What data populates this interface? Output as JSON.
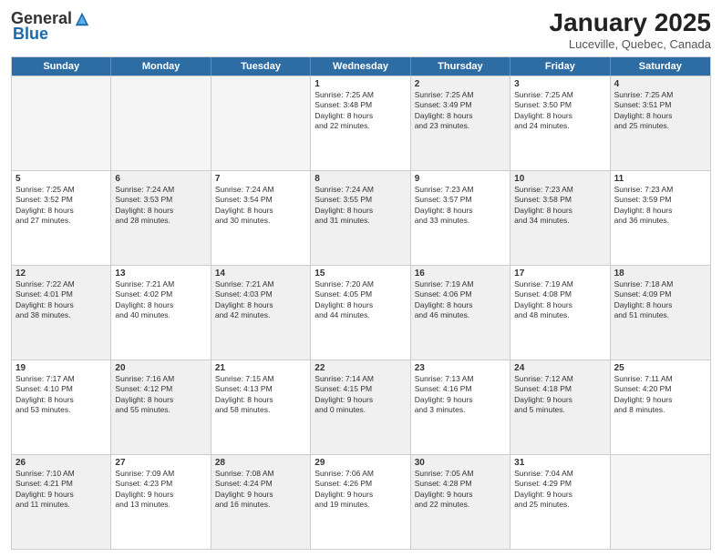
{
  "header": {
    "logo_general": "General",
    "logo_blue": "Blue",
    "month_title": "January 2025",
    "location": "Luceville, Quebec, Canada"
  },
  "days_of_week": [
    "Sunday",
    "Monday",
    "Tuesday",
    "Wednesday",
    "Thursday",
    "Friday",
    "Saturday"
  ],
  "weeks": [
    [
      {
        "day": "",
        "text": "",
        "shaded": true,
        "empty": true
      },
      {
        "day": "",
        "text": "",
        "shaded": true,
        "empty": true
      },
      {
        "day": "",
        "text": "",
        "shaded": true,
        "empty": true
      },
      {
        "day": "1",
        "text": "Sunrise: 7:25 AM\nSunset: 3:48 PM\nDaylight: 8 hours\nand 22 minutes.",
        "shaded": false
      },
      {
        "day": "2",
        "text": "Sunrise: 7:25 AM\nSunset: 3:49 PM\nDaylight: 8 hours\nand 23 minutes.",
        "shaded": true
      },
      {
        "day": "3",
        "text": "Sunrise: 7:25 AM\nSunset: 3:50 PM\nDaylight: 8 hours\nand 24 minutes.",
        "shaded": false
      },
      {
        "day": "4",
        "text": "Sunrise: 7:25 AM\nSunset: 3:51 PM\nDaylight: 8 hours\nand 25 minutes.",
        "shaded": true
      }
    ],
    [
      {
        "day": "5",
        "text": "Sunrise: 7:25 AM\nSunset: 3:52 PM\nDaylight: 8 hours\nand 27 minutes.",
        "shaded": false
      },
      {
        "day": "6",
        "text": "Sunrise: 7:24 AM\nSunset: 3:53 PM\nDaylight: 8 hours\nand 28 minutes.",
        "shaded": true
      },
      {
        "day": "7",
        "text": "Sunrise: 7:24 AM\nSunset: 3:54 PM\nDaylight: 8 hours\nand 30 minutes.",
        "shaded": false
      },
      {
        "day": "8",
        "text": "Sunrise: 7:24 AM\nSunset: 3:55 PM\nDaylight: 8 hours\nand 31 minutes.",
        "shaded": true
      },
      {
        "day": "9",
        "text": "Sunrise: 7:23 AM\nSunset: 3:57 PM\nDaylight: 8 hours\nand 33 minutes.",
        "shaded": false
      },
      {
        "day": "10",
        "text": "Sunrise: 7:23 AM\nSunset: 3:58 PM\nDaylight: 8 hours\nand 34 minutes.",
        "shaded": true
      },
      {
        "day": "11",
        "text": "Sunrise: 7:23 AM\nSunset: 3:59 PM\nDaylight: 8 hours\nand 36 minutes.",
        "shaded": false
      }
    ],
    [
      {
        "day": "12",
        "text": "Sunrise: 7:22 AM\nSunset: 4:01 PM\nDaylight: 8 hours\nand 38 minutes.",
        "shaded": true
      },
      {
        "day": "13",
        "text": "Sunrise: 7:21 AM\nSunset: 4:02 PM\nDaylight: 8 hours\nand 40 minutes.",
        "shaded": false
      },
      {
        "day": "14",
        "text": "Sunrise: 7:21 AM\nSunset: 4:03 PM\nDaylight: 8 hours\nand 42 minutes.",
        "shaded": true
      },
      {
        "day": "15",
        "text": "Sunrise: 7:20 AM\nSunset: 4:05 PM\nDaylight: 8 hours\nand 44 minutes.",
        "shaded": false
      },
      {
        "day": "16",
        "text": "Sunrise: 7:19 AM\nSunset: 4:06 PM\nDaylight: 8 hours\nand 46 minutes.",
        "shaded": true
      },
      {
        "day": "17",
        "text": "Sunrise: 7:19 AM\nSunset: 4:08 PM\nDaylight: 8 hours\nand 48 minutes.",
        "shaded": false
      },
      {
        "day": "18",
        "text": "Sunrise: 7:18 AM\nSunset: 4:09 PM\nDaylight: 8 hours\nand 51 minutes.",
        "shaded": true
      }
    ],
    [
      {
        "day": "19",
        "text": "Sunrise: 7:17 AM\nSunset: 4:10 PM\nDaylight: 8 hours\nand 53 minutes.",
        "shaded": false
      },
      {
        "day": "20",
        "text": "Sunrise: 7:16 AM\nSunset: 4:12 PM\nDaylight: 8 hours\nand 55 minutes.",
        "shaded": true
      },
      {
        "day": "21",
        "text": "Sunrise: 7:15 AM\nSunset: 4:13 PM\nDaylight: 8 hours\nand 58 minutes.",
        "shaded": false
      },
      {
        "day": "22",
        "text": "Sunrise: 7:14 AM\nSunset: 4:15 PM\nDaylight: 9 hours\nand 0 minutes.",
        "shaded": true
      },
      {
        "day": "23",
        "text": "Sunrise: 7:13 AM\nSunset: 4:16 PM\nDaylight: 9 hours\nand 3 minutes.",
        "shaded": false
      },
      {
        "day": "24",
        "text": "Sunrise: 7:12 AM\nSunset: 4:18 PM\nDaylight: 9 hours\nand 5 minutes.",
        "shaded": true
      },
      {
        "day": "25",
        "text": "Sunrise: 7:11 AM\nSunset: 4:20 PM\nDaylight: 9 hours\nand 8 minutes.",
        "shaded": false
      }
    ],
    [
      {
        "day": "26",
        "text": "Sunrise: 7:10 AM\nSunset: 4:21 PM\nDaylight: 9 hours\nand 11 minutes.",
        "shaded": true
      },
      {
        "day": "27",
        "text": "Sunrise: 7:09 AM\nSunset: 4:23 PM\nDaylight: 9 hours\nand 13 minutes.",
        "shaded": false
      },
      {
        "day": "28",
        "text": "Sunrise: 7:08 AM\nSunset: 4:24 PM\nDaylight: 9 hours\nand 16 minutes.",
        "shaded": true
      },
      {
        "day": "29",
        "text": "Sunrise: 7:06 AM\nSunset: 4:26 PM\nDaylight: 9 hours\nand 19 minutes.",
        "shaded": false
      },
      {
        "day": "30",
        "text": "Sunrise: 7:05 AM\nSunset: 4:28 PM\nDaylight: 9 hours\nand 22 minutes.",
        "shaded": true
      },
      {
        "day": "31",
        "text": "Sunrise: 7:04 AM\nSunset: 4:29 PM\nDaylight: 9 hours\nand 25 minutes.",
        "shaded": false
      },
      {
        "day": "",
        "text": "",
        "shaded": true,
        "empty": true
      }
    ]
  ]
}
